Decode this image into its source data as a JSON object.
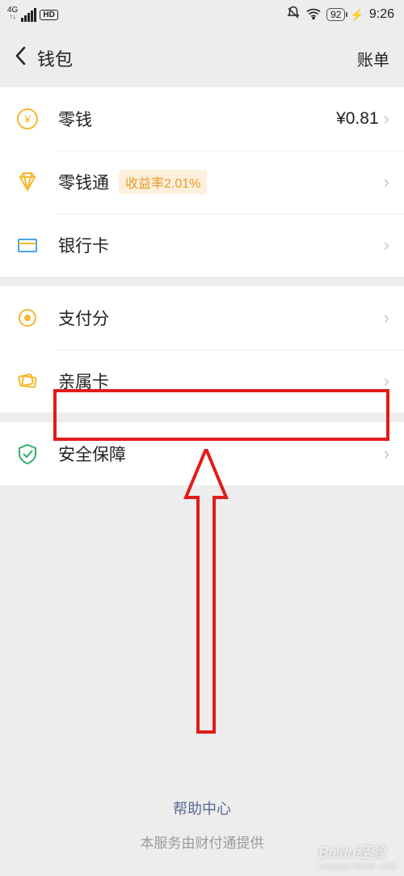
{
  "status": {
    "network": "4G",
    "hd": "HD",
    "battery": "92",
    "time": "9:26"
  },
  "header": {
    "title": "钱包",
    "bill": "账单"
  },
  "rows": {
    "balance": {
      "label": "零钱",
      "value": "¥0.81"
    },
    "balance_plus": {
      "label": "零钱通",
      "tag": "收益率2.01%"
    },
    "bank_card": {
      "label": "银行卡"
    },
    "pay_score": {
      "label": "支付分"
    },
    "family_card": {
      "label": "亲属卡"
    },
    "security": {
      "label": "安全保障"
    }
  },
  "footer": {
    "help": "帮助中心",
    "provider": "本服务由财付通提供"
  },
  "watermark": {
    "main": "Baidu经验",
    "sub": "jingyan.baidu.com"
  }
}
